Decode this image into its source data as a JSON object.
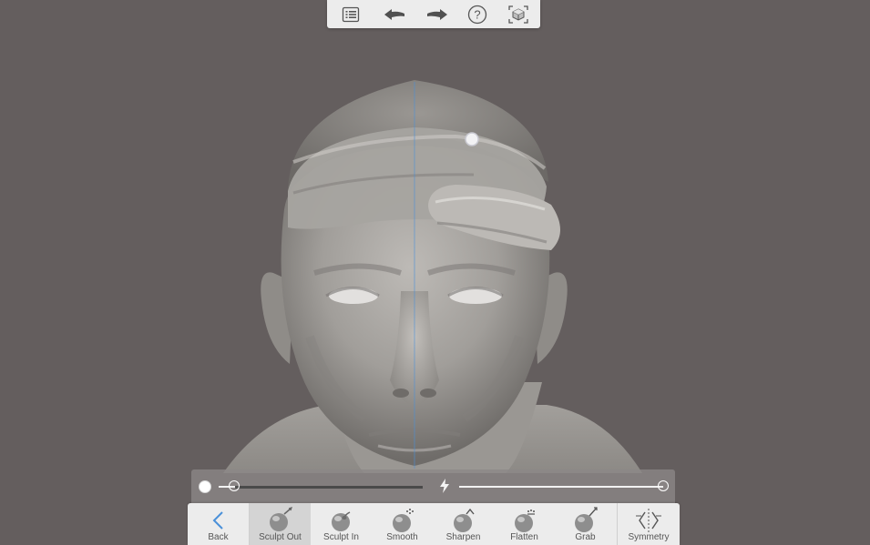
{
  "app": {
    "background_color": "#645e5e",
    "accent_color": "#4a90d9"
  },
  "top_toolbar": {
    "buttons": [
      {
        "id": "menu",
        "icon": "list-icon"
      },
      {
        "id": "undo",
        "icon": "undo-arrow-icon"
      },
      {
        "id": "redo",
        "icon": "redo-arrow-icon"
      },
      {
        "id": "help",
        "icon": "help-icon"
      },
      {
        "id": "view",
        "icon": "view-cube-icon"
      }
    ]
  },
  "brush_controls": {
    "size_value": 0.08,
    "strength_icon": "lightning-icon",
    "strength_value": 1.0
  },
  "tools": [
    {
      "label": "Back",
      "icon": "chevron-left-icon",
      "active": false
    },
    {
      "label": "Sculpt Out",
      "icon": "sculpt-out-icon",
      "active": true
    },
    {
      "label": "Sculpt In",
      "icon": "sculpt-in-icon",
      "active": false
    },
    {
      "label": "Smooth",
      "icon": "smooth-icon",
      "active": false
    },
    {
      "label": "Sharpen",
      "icon": "sharpen-icon",
      "active": false
    },
    {
      "label": "Flatten",
      "icon": "flatten-icon",
      "active": false
    },
    {
      "label": "Grab",
      "icon": "grab-icon",
      "active": false
    },
    {
      "label": "Symmetry",
      "icon": "symmetry-icon",
      "active": false
    }
  ]
}
